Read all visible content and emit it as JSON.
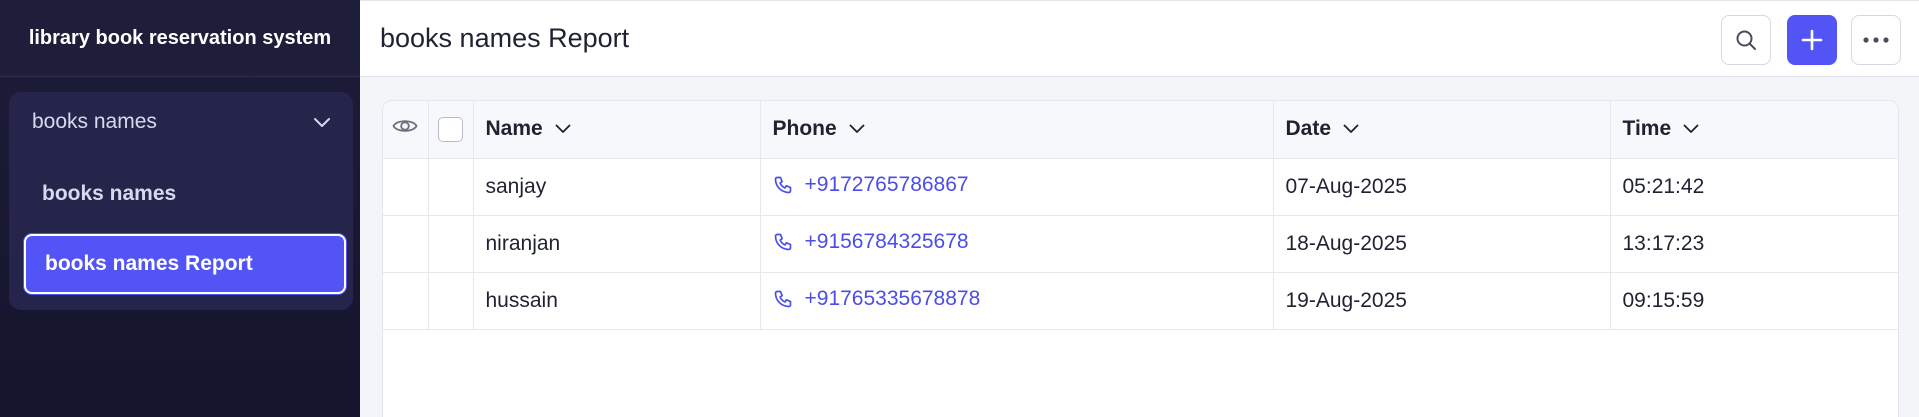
{
  "sidebar": {
    "app_title": "library book reservation system",
    "group": {
      "label": "books names",
      "icon": "chevron-down-icon"
    },
    "items": [
      {
        "label": "books names",
        "active": false
      },
      {
        "label": "books names Report",
        "active": true
      }
    ]
  },
  "header": {
    "title": "books names Report",
    "actions": [
      {
        "icon": "search-icon"
      },
      {
        "icon": "plus-icon"
      },
      {
        "icon": "more-horizontal-icon"
      }
    ]
  },
  "table": {
    "columns": [
      "Name",
      "Phone",
      "Date",
      "Time"
    ],
    "rows": [
      {
        "name": "sanjay",
        "phone": "+9172765786867",
        "date": "07-Aug-2025",
        "time": "05:21:42"
      },
      {
        "name": "niranjan",
        "phone": "+9156784325678",
        "date": "18-Aug-2025",
        "time": "13:17:23"
      },
      {
        "name": "hussain",
        "phone": "+91765335678878",
        "date": "19-Aug-2025",
        "time": "09:15:59"
      }
    ]
  },
  "colors": {
    "accent": "#5254f5",
    "sidebar_bg": "#1e1d3a",
    "link": "#4b4de8"
  }
}
